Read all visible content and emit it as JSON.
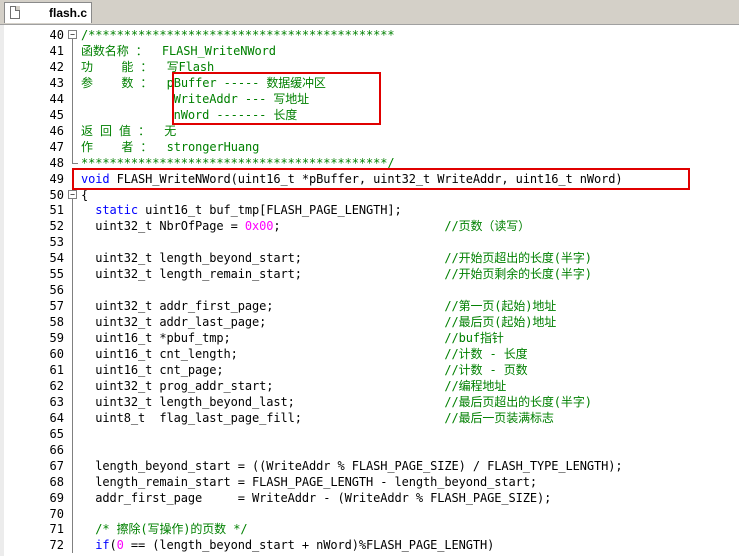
{
  "tab": {
    "label": "flash.c"
  },
  "lines": [
    {
      "n": "40",
      "fold": "box",
      "segs": [
        {
          "t": "/*******************************************",
          "c": "cmt"
        }
      ]
    },
    {
      "n": "41",
      "fold": "line",
      "segs": [
        {
          "t": "函数名称 ：  FLASH_WriteNWord",
          "c": "cmt"
        }
      ]
    },
    {
      "n": "42",
      "fold": "line",
      "segs": [
        {
          "t": "功    能 ：  写Flash",
          "c": "cmt"
        }
      ]
    },
    {
      "n": "43",
      "fold": "line",
      "segs": [
        {
          "t": "参    数 ：  pBuffer ----- 数据缓冲区",
          "c": "cmt"
        }
      ]
    },
    {
      "n": "44",
      "fold": "line",
      "segs": [
        {
          "t": "             WriteAddr --- 写地址",
          "c": "cmt"
        }
      ]
    },
    {
      "n": "45",
      "fold": "line",
      "segs": [
        {
          "t": "             nWord ------- 长度",
          "c": "cmt"
        }
      ]
    },
    {
      "n": "46",
      "fold": "line",
      "segs": [
        {
          "t": "返 回 值 ：  无",
          "c": "cmt"
        }
      ]
    },
    {
      "n": "47",
      "fold": "line",
      "segs": [
        {
          "t": "作    者 ：  strongerHuang",
          "c": "cmt"
        }
      ]
    },
    {
      "n": "48",
      "fold": "end",
      "segs": [
        {
          "t": "*******************************************/",
          "c": "cmt"
        }
      ]
    },
    {
      "n": "49",
      "fold": "",
      "segs": [
        {
          "t": "void",
          "c": "kw"
        },
        {
          "t": " FLASH_WriteNWord(uint16_t *pBuffer, uint32_t WriteAddr, uint16_t nWord)",
          "c": ""
        }
      ]
    },
    {
      "n": "50",
      "fold": "box",
      "segs": [
        {
          "t": "{",
          "c": ""
        }
      ]
    },
    {
      "n": "51",
      "fold": "line",
      "segs": [
        {
          "t": "  ",
          "c": ""
        },
        {
          "t": "static",
          "c": "kw"
        },
        {
          "t": " uint16_t buf_tmp[FLASH_PAGE_LENGTH];",
          "c": ""
        }
      ]
    },
    {
      "n": "52",
      "fold": "line",
      "segs": [
        {
          "t": "  uint32_t NbrOfPage = ",
          "c": ""
        },
        {
          "t": "0x00",
          "c": "num"
        },
        {
          "t": ";                       ",
          "c": ""
        },
        {
          "t": "//页数（读写）",
          "c": "cmt"
        }
      ]
    },
    {
      "n": "53",
      "fold": "line",
      "segs": [
        {
          "t": "",
          "c": ""
        }
      ]
    },
    {
      "n": "54",
      "fold": "line",
      "segs": [
        {
          "t": "  uint32_t length_beyond_start;                    ",
          "c": ""
        },
        {
          "t": "//开始页超出的长度(半字)",
          "c": "cmt"
        }
      ]
    },
    {
      "n": "55",
      "fold": "line",
      "segs": [
        {
          "t": "  uint32_t length_remain_start;                    ",
          "c": ""
        },
        {
          "t": "//开始页剩余的长度(半字)",
          "c": "cmt"
        }
      ]
    },
    {
      "n": "56",
      "fold": "line",
      "segs": [
        {
          "t": "",
          "c": ""
        }
      ]
    },
    {
      "n": "57",
      "fold": "line",
      "segs": [
        {
          "t": "  uint32_t addr_first_page;                        ",
          "c": ""
        },
        {
          "t": "//第一页(起始)地址",
          "c": "cmt"
        }
      ]
    },
    {
      "n": "58",
      "fold": "line",
      "segs": [
        {
          "t": "  uint32_t addr_last_page;                         ",
          "c": ""
        },
        {
          "t": "//最后页(起始)地址",
          "c": "cmt"
        }
      ]
    },
    {
      "n": "59",
      "fold": "line",
      "segs": [
        {
          "t": "  uint16_t *pbuf_tmp;                              ",
          "c": ""
        },
        {
          "t": "//buf指针",
          "c": "cmt"
        }
      ]
    },
    {
      "n": "60",
      "fold": "line",
      "segs": [
        {
          "t": "  uint16_t cnt_length;                             ",
          "c": ""
        },
        {
          "t": "//计数 - 长度",
          "c": "cmt"
        }
      ]
    },
    {
      "n": "61",
      "fold": "line",
      "segs": [
        {
          "t": "  uint16_t cnt_page;                               ",
          "c": ""
        },
        {
          "t": "//计数 - 页数",
          "c": "cmt"
        }
      ]
    },
    {
      "n": "62",
      "fold": "line",
      "segs": [
        {
          "t": "  uint32_t prog_addr_start;                        ",
          "c": ""
        },
        {
          "t": "//编程地址",
          "c": "cmt"
        }
      ]
    },
    {
      "n": "63",
      "fold": "line",
      "segs": [
        {
          "t": "  uint32_t length_beyond_last;                     ",
          "c": ""
        },
        {
          "t": "//最后页超出的长度(半字)",
          "c": "cmt"
        }
      ]
    },
    {
      "n": "64",
      "fold": "line",
      "segs": [
        {
          "t": "  uint8_t  flag_last_page_fill;                    ",
          "c": ""
        },
        {
          "t": "//最后一页装满标志",
          "c": "cmt"
        }
      ]
    },
    {
      "n": "65",
      "fold": "line",
      "segs": [
        {
          "t": "",
          "c": ""
        }
      ]
    },
    {
      "n": "66",
      "fold": "line",
      "segs": [
        {
          "t": "",
          "c": ""
        }
      ]
    },
    {
      "n": "67",
      "fold": "line",
      "segs": [
        {
          "t": "  length_beyond_start = ((WriteAddr % FLASH_PAGE_SIZE) / FLASH_TYPE_LENGTH);",
          "c": ""
        }
      ]
    },
    {
      "n": "68",
      "fold": "line",
      "segs": [
        {
          "t": "  length_remain_start = FLASH_PAGE_LENGTH - length_beyond_start;",
          "c": ""
        }
      ]
    },
    {
      "n": "69",
      "fold": "line",
      "segs": [
        {
          "t": "  addr_first_page     = WriteAddr - (WriteAddr % FLASH_PAGE_SIZE);",
          "c": ""
        }
      ]
    },
    {
      "n": "70",
      "fold": "line",
      "segs": [
        {
          "t": "",
          "c": ""
        }
      ]
    },
    {
      "n": "71",
      "fold": "line",
      "segs": [
        {
          "t": "  ",
          "c": ""
        },
        {
          "t": "/* 擦除(写操作)的页数 */",
          "c": "cmt"
        }
      ]
    },
    {
      "n": "72",
      "fold": "line",
      "segs": [
        {
          "t": "  ",
          "c": ""
        },
        {
          "t": "if",
          "c": "kw"
        },
        {
          "t": "(",
          "c": ""
        },
        {
          "t": "0",
          "c": "num"
        },
        {
          "t": " == (length_beyond_start + nWord)%FLASH_PAGE_LENGTH)",
          "c": ""
        }
      ]
    }
  ]
}
